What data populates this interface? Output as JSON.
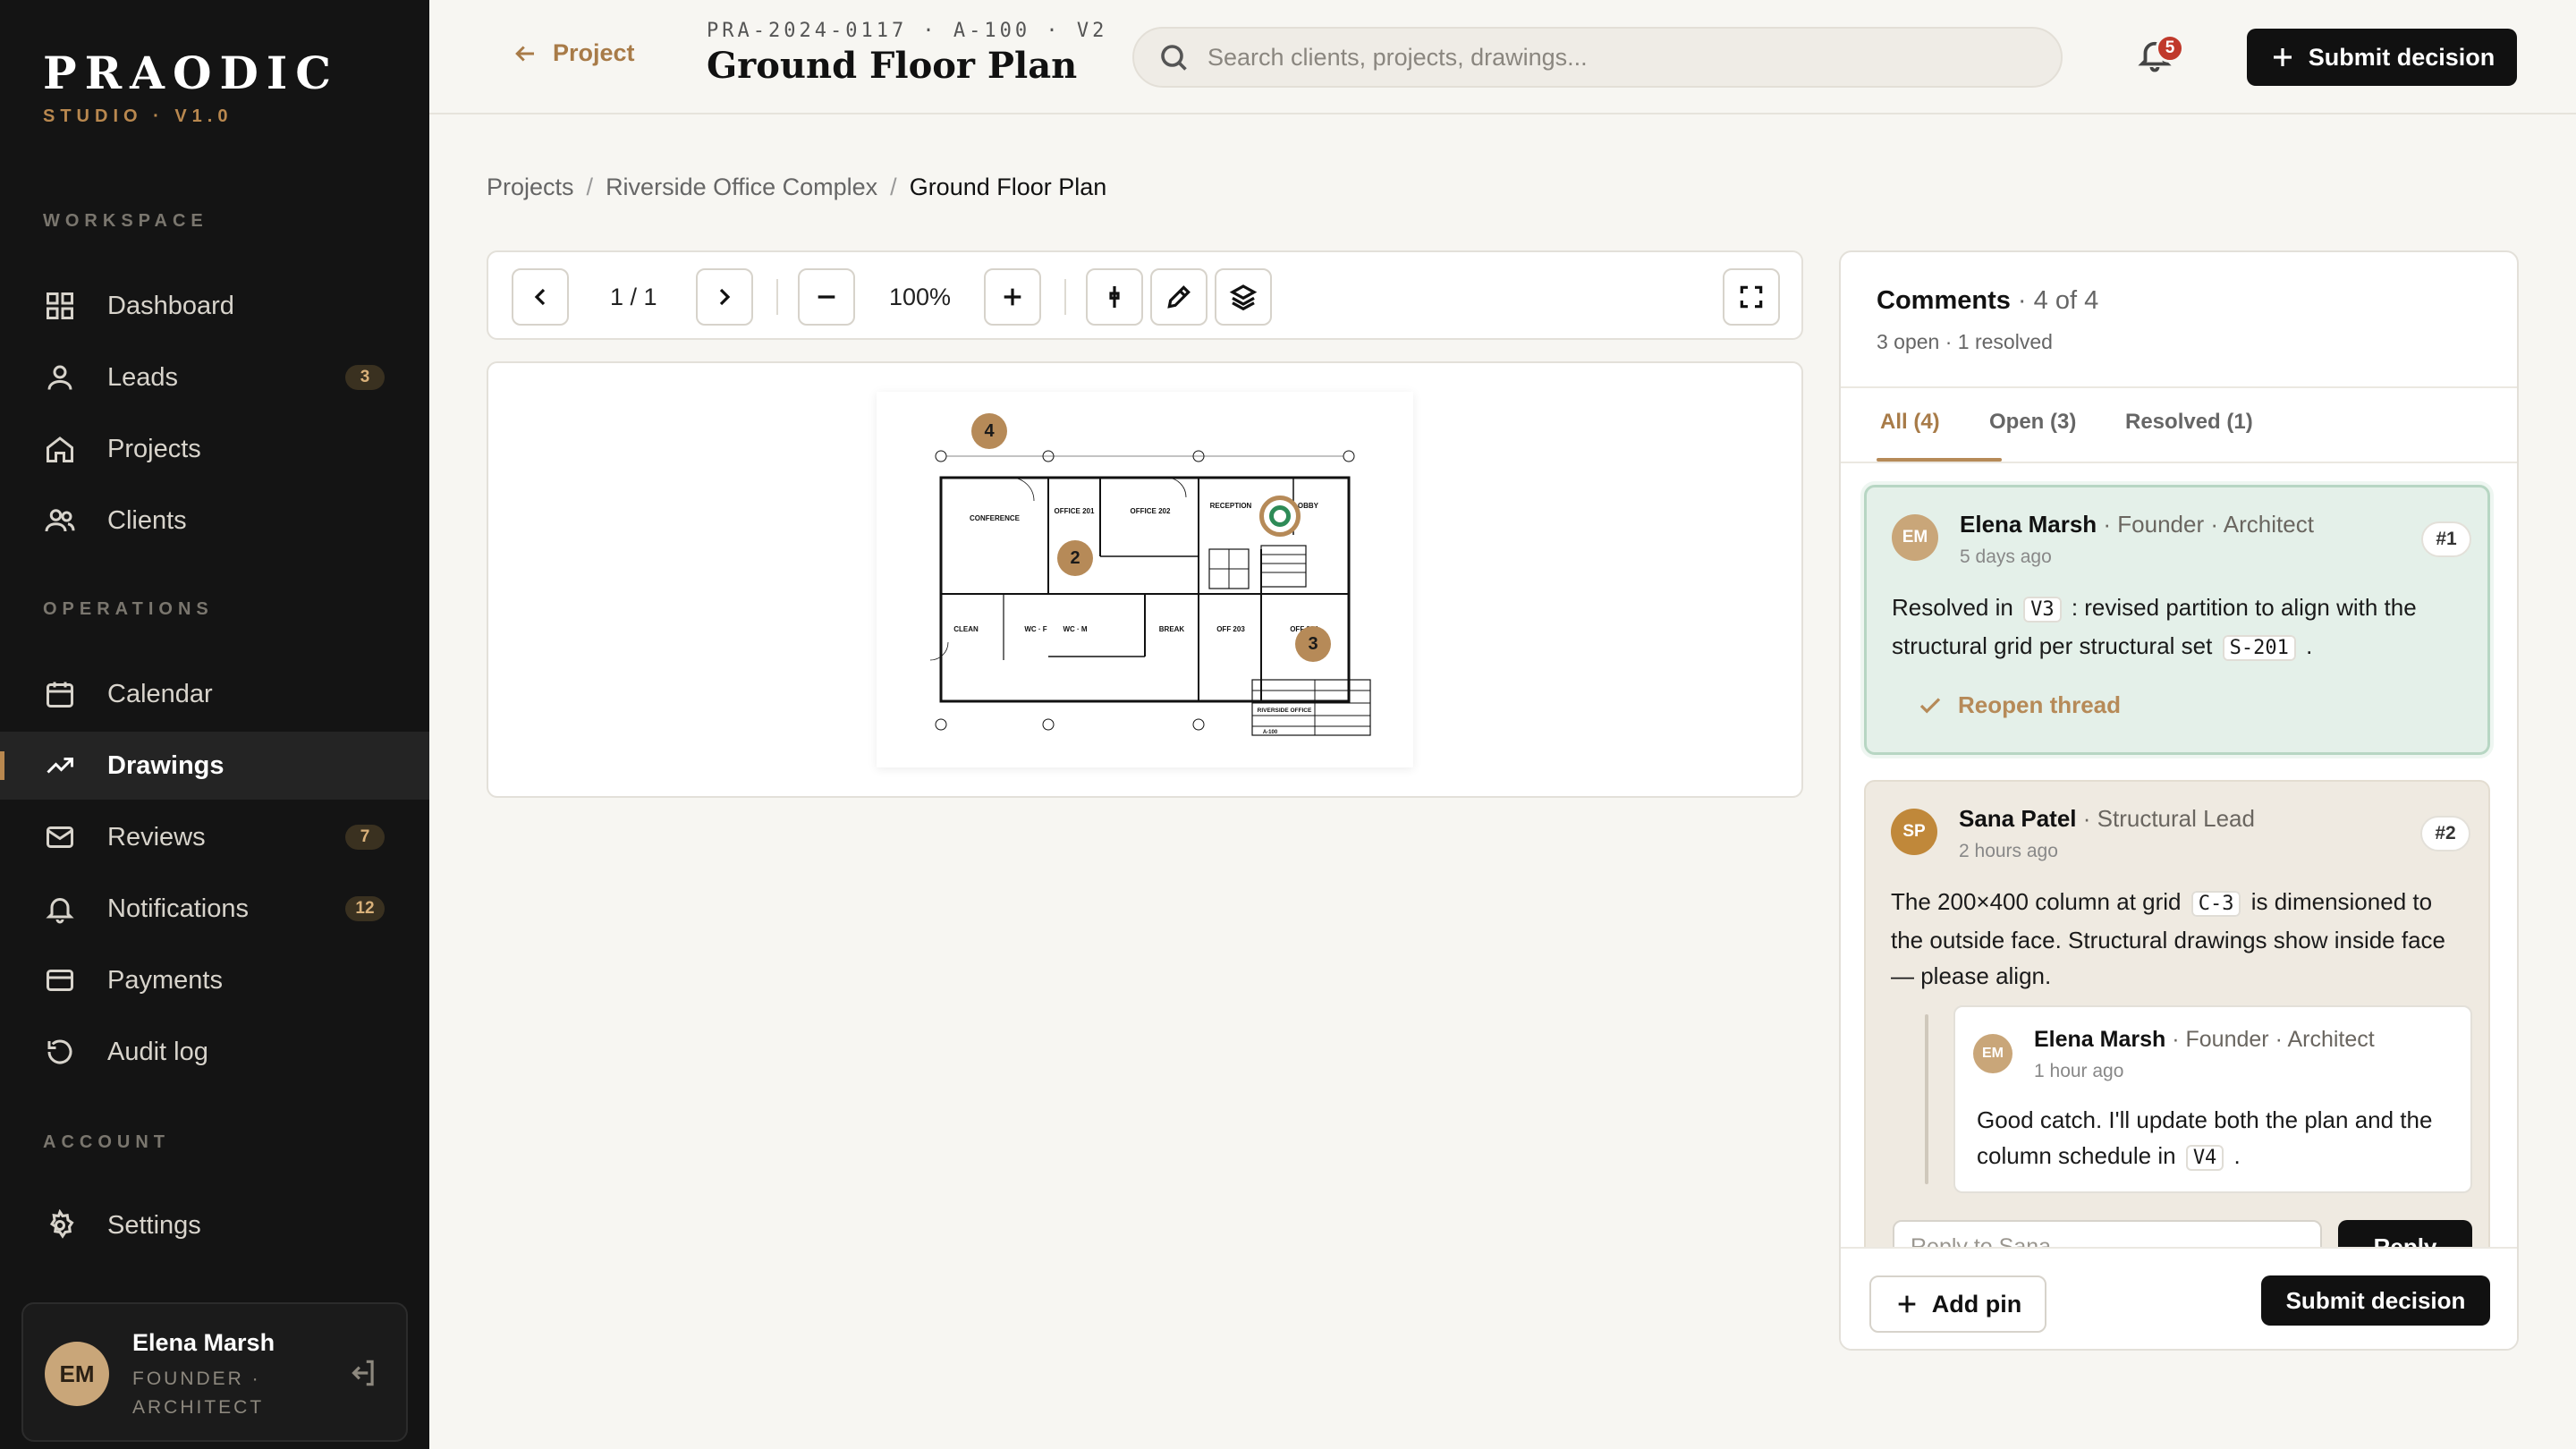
{
  "brand": {
    "name": "PRAODIC",
    "sub": "STUDIO · V1.0"
  },
  "nav": {
    "sections": {
      "workspace": "WORKSPACE",
      "operations": "OPERATIONS",
      "account": "ACCOUNT"
    },
    "workspace": [
      {
        "label": "Dashboard",
        "icon": "dashboard-icon"
      },
      {
        "label": "Leads",
        "icon": "user-icon",
        "badge": "3"
      },
      {
        "label": "Projects",
        "icon": "home-icon"
      },
      {
        "label": "Clients",
        "icon": "users-icon"
      }
    ],
    "operations": [
      {
        "label": "Calendar",
        "icon": "calendar-icon"
      },
      {
        "label": "Drawings",
        "icon": "trend-icon",
        "active": true
      },
      {
        "label": "Reviews",
        "icon": "mail-icon",
        "badge": "7"
      },
      {
        "label": "Notifications",
        "icon": "bell-icon",
        "badge": "12"
      },
      {
        "label": "Payments",
        "icon": "card-icon"
      },
      {
        "label": "Audit log",
        "icon": "history-icon"
      }
    ],
    "account": [
      {
        "label": "Settings",
        "icon": "gear-icon"
      }
    ]
  },
  "user": {
    "initials": "EM",
    "name": "Elena Marsh",
    "role": "FOUNDER · ARCHITECT"
  },
  "topbar": {
    "back_label": "Project",
    "doc_code": "PRA-2024-0117 · A-100 · V2",
    "doc_title": "Ground Floor Plan",
    "search_placeholder": "Search clients, projects, drawings...",
    "notif_count": "5",
    "submit_label": "Submit decision"
  },
  "breadcrumb": [
    "Projects",
    "Riverside Office Complex",
    "Ground Floor Plan"
  ],
  "toolbar": {
    "page": "1 / 1",
    "zoom": "100%"
  },
  "drawing": {
    "rooms": [
      "CONFERENCE",
      "OFFICE 201",
      "OFFICE 202",
      "RECEPTION",
      "LOBBY",
      "CLEAN",
      "WC · F",
      "WC · M",
      "BREAK",
      "OFF 203",
      "OFF 204"
    ],
    "title_block": "RIVERSIDE OFFICE",
    "sheet_no": "A-100",
    "pins": [
      "4",
      "2",
      "3"
    ]
  },
  "comments": {
    "title": "Comments",
    "count": "4 of 4",
    "summary": "3 open · 1 resolved",
    "tabs": [
      "All (4)",
      "Open (3)",
      "Resolved (1)"
    ],
    "threads": [
      {
        "initials": "EM",
        "name": "Elena Marsh",
        "role": "· Founder · Architect",
        "time": "5 days ago",
        "num": "#1",
        "body_a": "Resolved in",
        "code_a": "V3",
        "body_b": ": revised partition to align with the structural grid per structural set",
        "code_b": "S-201",
        "body_c": ".",
        "action": "Reopen thread"
      },
      {
        "initials": "SP",
        "name": "Sana Patel",
        "role": "· Structural Lead",
        "time": "2 hours ago",
        "num": "#2",
        "body_a": "The 200×400 column at grid",
        "code_a": "C-3",
        "body_b": "is dimensioned to the outside face. Structural drawings show inside face — please align.",
        "reply": {
          "initials": "EM",
          "name": "Elena Marsh",
          "role": "· Founder · Architect",
          "time": "1 hour ago",
          "body_a": "Good catch. I'll update both the plan and the column schedule in",
          "code_a": "V4",
          "body_b": "."
        },
        "reply_placeholder": "Reply to Sana...",
        "reply_button": "Reply"
      }
    ],
    "add_pin": "Add pin",
    "submit": "Submit decision"
  }
}
